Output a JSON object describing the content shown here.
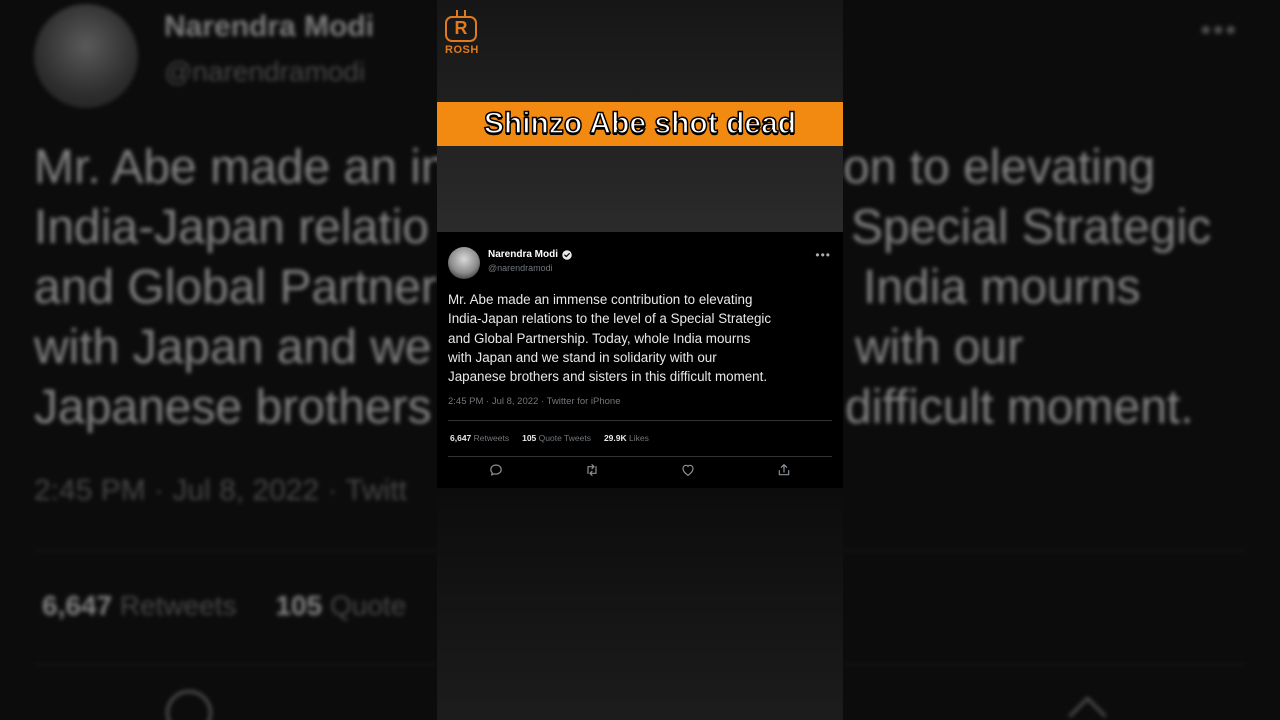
{
  "overlay": {
    "brand_text": "ROSH",
    "brand_letter": "R",
    "headline": "Shinzo Abe shot dead",
    "accent": "#f28a12"
  },
  "tweet": {
    "name": "Narendra Modi",
    "handle": "@narendramodi",
    "more_icon": "•••",
    "lines": [
      "Mr. Abe made an immense contribution to elevating",
      "India-Japan relations to the level of a Special Strategic",
      "and Global Partnership. Today, whole India mourns",
      "with Japan and we stand in solidarity with our",
      "Japanese brothers and sisters in this difficult moment."
    ],
    "meta": "2:45 PM · Jul 8, 2022 · Twitter for iPhone",
    "retweets_count": "6,647",
    "retweets_label": "Retweets",
    "quotes_count": "105",
    "quotes_label": "Quote Tweets",
    "likes_count": "29.9K",
    "likes_label": "Likes",
    "icons": [
      "reply-icon",
      "retweet-icon",
      "like-icon",
      "share-icon"
    ]
  },
  "background": {
    "name": "Narendra Modi",
    "handle": "@narendramodi",
    "more_icon": "•••",
    "lines": [
      "Mr. Abe made an in",
      "India-Japan relatio",
      "and Global Partner",
      "with Japan and we",
      "Japanese brothers"
    ],
    "lines_right": [
      "on to elevating",
      "Special Strategic",
      "India mourns",
      "with our",
      "difficult moment."
    ],
    "meta": "2:45 PM · Jul 8, 2022 · Twitt",
    "retweets_count": "6,647",
    "retweets_label": "Retweets",
    "quotes_count": "105",
    "quotes_label": "Quote"
  }
}
